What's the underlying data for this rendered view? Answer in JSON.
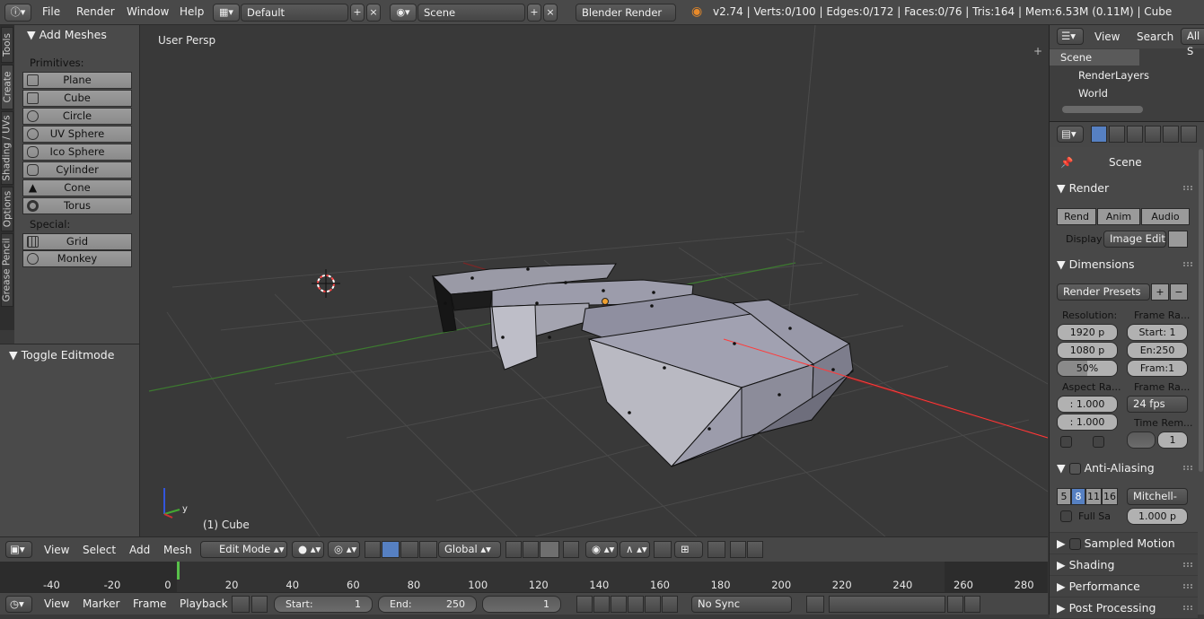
{
  "topbar": {
    "menus": [
      "File",
      "Render",
      "Window",
      "Help"
    ],
    "layout": "Default",
    "scene": "Scene",
    "engine": "Blender Render",
    "stats": "v2.74 | Verts:0/100 | Edges:0/172 | Faces:0/76 | Tris:164 | Mem:6.53M (0.11M) | Cube"
  },
  "left_tabs": [
    "Tools",
    "Create",
    "Shading / UVs",
    "Options",
    "Grease Pencil"
  ],
  "tool_panel": {
    "title": "Add Meshes",
    "primitives_label": "Primitives:",
    "primitives": [
      "Plane",
      "Cube",
      "Circle",
      "UV Sphere",
      "Ico Sphere",
      "Cylinder",
      "Cone",
      "Torus"
    ],
    "special_label": "Special:",
    "special": [
      "Grid",
      "Monkey"
    ],
    "operator_panel": "Toggle Editmode"
  },
  "viewport": {
    "view_label": "User Persp",
    "object_label": "(1) Cube",
    "axis_y": "y"
  },
  "view_header": {
    "menus": [
      "View",
      "Select",
      "Add",
      "Mesh"
    ],
    "mode": "Edit Mode",
    "orientation": "Global"
  },
  "timeline": {
    "ticks": [
      "-40",
      "-20",
      "0",
      "20",
      "40",
      "60",
      "80",
      "100",
      "120",
      "140",
      "160",
      "180",
      "200",
      "220",
      "240",
      "260",
      "280"
    ],
    "current_frame_marker": 1
  },
  "timeline_header": {
    "menus": [
      "View",
      "Marker",
      "Frame",
      "Playback"
    ],
    "start_label": "Start:",
    "start": "1",
    "end_label": "End:",
    "end": "250",
    "current": "1",
    "sync": "No Sync"
  },
  "outliner": {
    "menus": [
      "View",
      "Search",
      "All S"
    ],
    "items": [
      "Scene",
      "RenderLayers",
      "World"
    ]
  },
  "properties": {
    "context": "Scene",
    "render": {
      "title": "Render",
      "buttons": [
        "Rend",
        "Anim",
        "Audio"
      ],
      "display_label": "Display",
      "display_value": "Image Edit"
    },
    "dimensions": {
      "title": "Dimensions",
      "presets": "Render Presets",
      "resolution_label": "Resolution:",
      "res_x": "1920 p",
      "res_y": "1080 p",
      "res_pct": "50%",
      "frame_range_label": "Frame Ra...",
      "start": "Start: 1",
      "end": "En:250",
      "step": "Fram:1",
      "aspect_label": "Aspect Ra...",
      "aspect_x": ": 1.000",
      "aspect_y": ": 1.000",
      "frame_rate_label": "Frame Ra...",
      "fps": "24 fps",
      "time_remap_label": "Time Rem...",
      "time_remap": "1"
    },
    "anti_aliasing": {
      "title": "Anti-Aliasing",
      "samples": [
        "5",
        "8",
        "11",
        "16"
      ],
      "active": "8",
      "filter": "Mitchell-",
      "full_sample_label": "Full Sa",
      "size": "1.000 p"
    },
    "collapsed": [
      "Sampled Motion Blur",
      "Shading",
      "Performance",
      "Post Processing"
    ]
  },
  "colors": {
    "accent": "#5680c2",
    "selected_edge": "#ff3b3b",
    "x_axis": "#8a2a2a",
    "y_axis": "#3f8a2f"
  }
}
